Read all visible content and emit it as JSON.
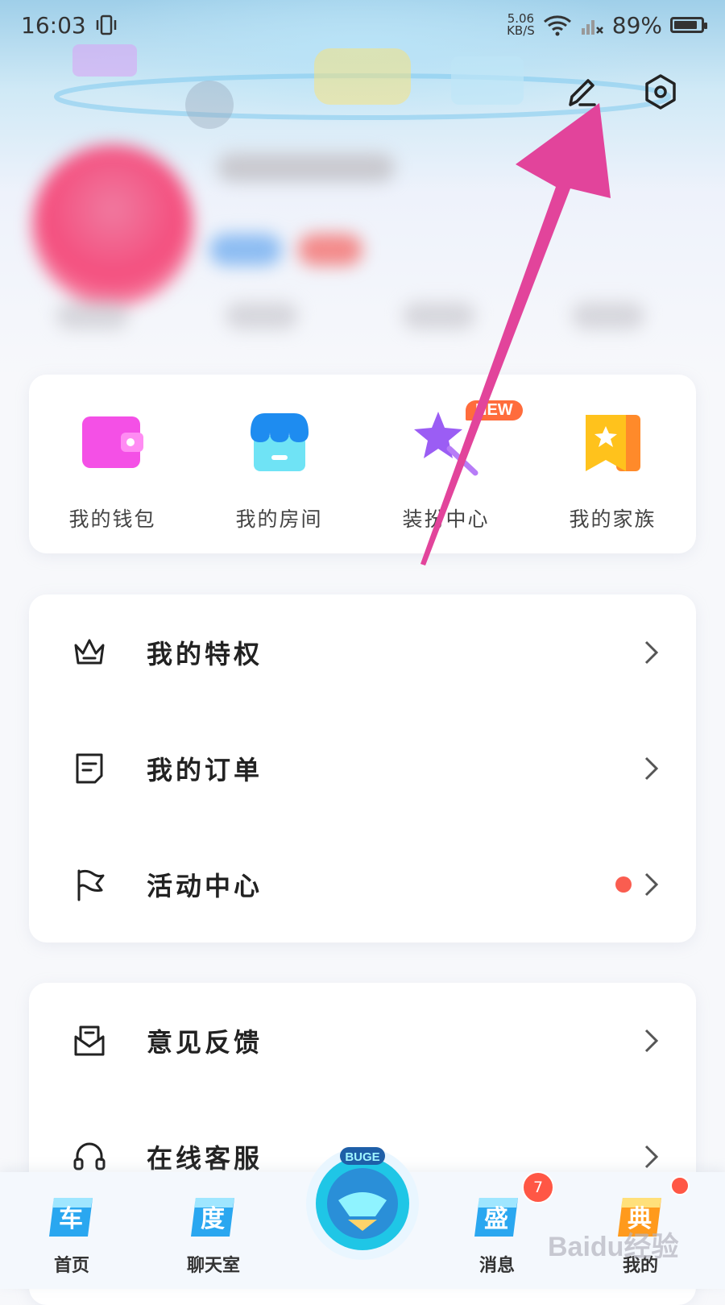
{
  "status_bar": {
    "time": "16:03",
    "net_speed_value": "5.06",
    "net_speed_unit": "KB/S",
    "battery_percent": "89%",
    "battery_level": 0.89
  },
  "quick_actions": [
    {
      "label": "我的钱包",
      "icon": "wallet-icon"
    },
    {
      "label": "我的房间",
      "icon": "store-icon"
    },
    {
      "label": "装扮中心",
      "icon": "magic-wand-star-icon",
      "badge": "NEW"
    },
    {
      "label": "我的家族",
      "icon": "family-bookmark-icon"
    }
  ],
  "menu_group_1": [
    {
      "label": "我的特权",
      "icon": "crown-icon"
    },
    {
      "label": "我的订单",
      "icon": "order-document-icon"
    },
    {
      "label": "活动中心",
      "icon": "flag-icon",
      "has_dot": true
    }
  ],
  "menu_group_2": [
    {
      "label": "意见反馈",
      "icon": "feedback-mail-icon"
    },
    {
      "label": "在线客服",
      "icon": "headset-icon"
    }
  ],
  "tab_bar": {
    "tabs": [
      {
        "label": "首页",
        "glyph": "车"
      },
      {
        "label": "聊天室",
        "glyph": "度"
      },
      {
        "label": "消息",
        "glyph": "盛",
        "badge": "7"
      },
      {
        "label": "我的",
        "glyph": "典"
      }
    ],
    "center_logo_text": "BUGE"
  },
  "watermark": "Baidu经验",
  "colors": {
    "annotation_arrow": "#e2449b",
    "accent_red": "#fa5d50",
    "new_badge": "#ff6c3c"
  }
}
